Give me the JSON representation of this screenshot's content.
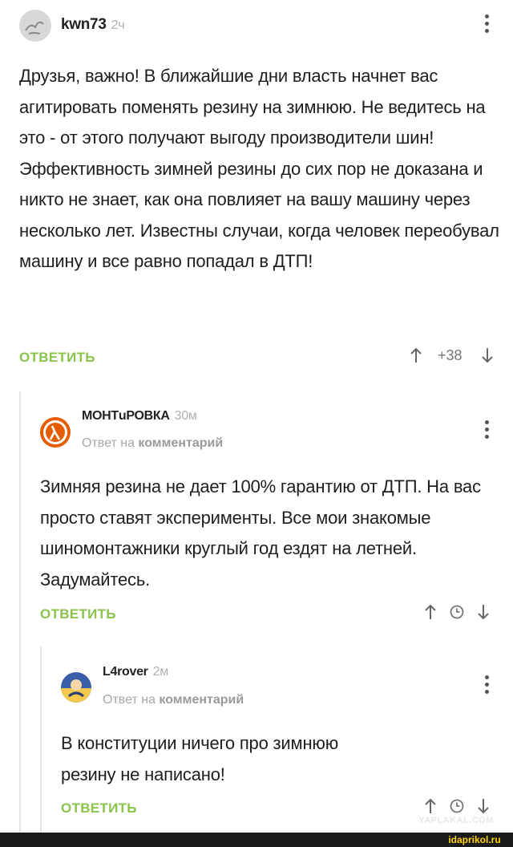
{
  "comments": [
    {
      "author": "kwn73",
      "time": "2ч",
      "text": "Друзья, важно! В ближайшие дни власть начнет вас агитировать поменять резину на зимнюю. Не ведитесь на это - от этого получают выгоду производители шин! Эффективность зимней резины до сих пор не доказана и никто не знает, как она повлияет на вашу машину через несколько лет. Известны случаи, когда человек переобувал машину и все равно попадал в ДТП!",
      "reply_label": "ОТВЕТИТЬ",
      "rating": "+38"
    },
    {
      "author": "МОНТuРОВКА",
      "time": "30м",
      "reply_prefix": "Ответ на",
      "reply_target": "комментарий",
      "text": "Зимняя резина не дает 100% гарантию от ДТП. На вас просто ставят эксперименты. Все мои знакомые шиномонтажники круглый год ездят на летней. Задумайтесь.",
      "reply_label": "ОТВЕТИТЬ"
    },
    {
      "author": "L4rover",
      "time": "2м",
      "reply_prefix": "Ответ на",
      "reply_target": "комментарий",
      "text": "В конституции ничего про зимнюю резину не написано!",
      "reply_label": "ОТВЕТИТЬ"
    }
  ],
  "watermarks": {
    "yaplakal": "YAPLAKAL.COM",
    "idaprikol": "idaprikol.ru"
  },
  "colors": {
    "reply_green": "#8bc34a",
    "muted_gray": "#b0b0b0"
  }
}
